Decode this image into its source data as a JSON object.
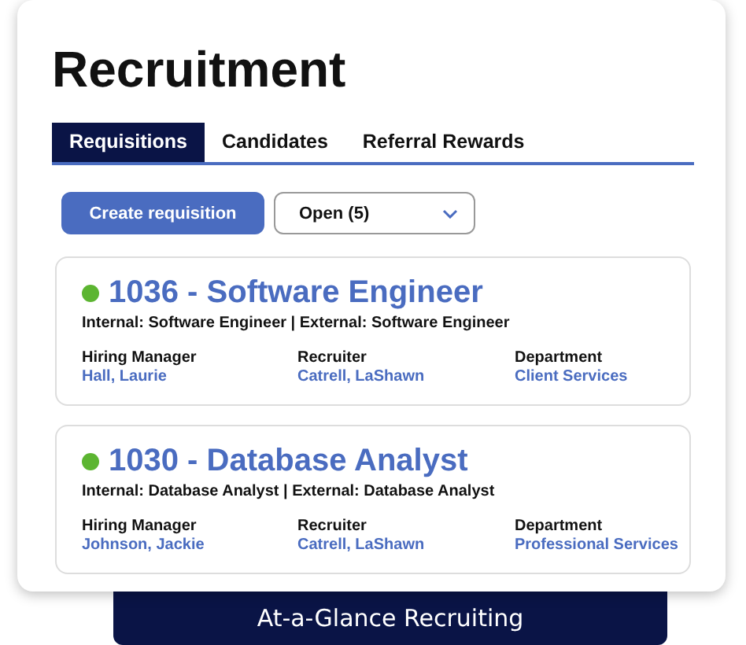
{
  "title": "Recruitment",
  "tabs": [
    {
      "label": "Requisitions",
      "selected": true
    },
    {
      "label": "Candidates",
      "selected": false
    },
    {
      "label": "Referral Rewards",
      "selected": false
    }
  ],
  "create_button": "Create requisition",
  "filter": {
    "value": "Open (5)"
  },
  "requisitions": [
    {
      "title": "1036 - Software Engineer",
      "color": "#5cb531",
      "subtitle": "Internal: Software Engineer | External: Software Engineer",
      "fields": [
        {
          "label": "Hiring Manager",
          "value": "Hall, Laurie"
        },
        {
          "label": "Recruiter",
          "value": "Catrell, LaShawn"
        },
        {
          "label": "Department",
          "value": "Client Services"
        }
      ]
    },
    {
      "title": "1030 - Database Analyst",
      "color": "#5cb531",
      "subtitle": "Internal: Database Analyst | External: Database Analyst",
      "fields": [
        {
          "label": "Hiring Manager",
          "value": "Johnson, Jackie"
        },
        {
          "label": "Recruiter",
          "value": "Catrell, LaShawn"
        },
        {
          "label": "Department",
          "value": "Professional Services"
        }
      ]
    }
  ],
  "banner": "At-a-Glance Recruiting"
}
